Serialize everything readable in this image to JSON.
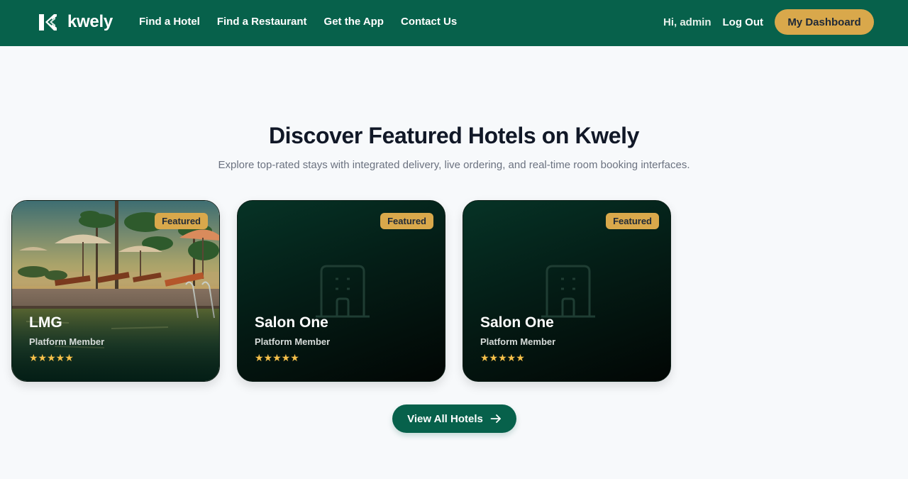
{
  "colors": {
    "nav_bg": "#07614b",
    "accent_gold": "#d9a84b",
    "page_bg": "#f7f9fb",
    "star": "#f5c04a"
  },
  "header": {
    "brand_name": "kwely",
    "logo_icon": "kwely-logo-icon",
    "nav": [
      {
        "label": "Find a Hotel"
      },
      {
        "label": "Find a Restaurant"
      },
      {
        "label": "Get the App"
      },
      {
        "label": "Contact Us"
      }
    ],
    "greeting": "Hi, admin",
    "logout_label": "Log Out",
    "dashboard_label": "My Dashboard"
  },
  "section": {
    "title": "Discover Featured Hotels on Kwely",
    "subtitle": "Explore top-rated stays with integrated delivery, live ordering, and real-time room booking interfaces."
  },
  "hotels": [
    {
      "badge": "Featured",
      "name": "LMG",
      "meta": "Platform Member",
      "rating": 5,
      "stars": "★★★★★",
      "image": "resort-pool-photo"
    },
    {
      "badge": "Featured",
      "name": "Salon One",
      "meta": "Platform Member",
      "rating": 5,
      "stars": "★★★★★",
      "image": "building-placeholder-icon"
    },
    {
      "badge": "Featured",
      "name": "Salon One",
      "meta": "Platform Member",
      "rating": 5,
      "stars": "★★★★★",
      "image": "building-placeholder-icon"
    }
  ],
  "cta": {
    "label": "View All Hotels",
    "icon": "arrow-right-icon"
  }
}
